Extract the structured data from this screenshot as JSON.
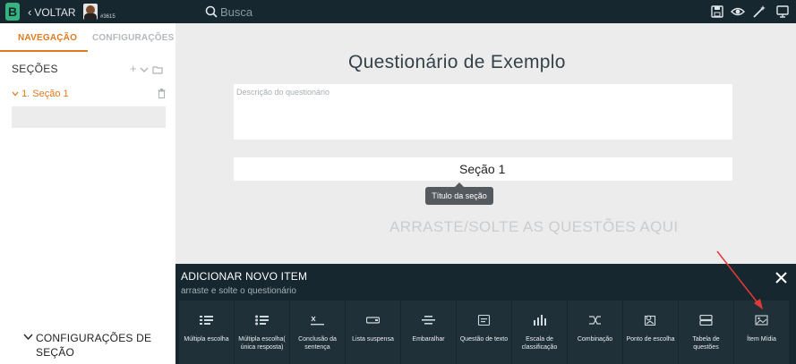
{
  "topbar": {
    "logo": "B",
    "back_label": "VOLTAR",
    "user_id": "#3615",
    "search_placeholder": "Busca",
    "icons": [
      "save-icon",
      "eye-icon",
      "magic-wand-icon",
      "monitor-icon"
    ]
  },
  "sidebar": {
    "tabs": [
      {
        "label": "NAVEGAÇÃO",
        "active": true
      },
      {
        "label": "CONFIGURAÇÕES",
        "active": false
      }
    ],
    "sections_title": "SEÇÕES",
    "section_item": "1. Seção 1",
    "section_config_title": "CONFIGURAÇÕES DE SEÇÃO"
  },
  "main": {
    "title": "Questionário de Exemplo",
    "description_placeholder": "Descrição do questionário",
    "section_title": "Seção 1",
    "tooltip": "Título da seção",
    "dropzone": "ARRASTE/SOLTE AS QUESTÕES AQUI"
  },
  "panel": {
    "title": "ADICIONAR NOVO ITEM",
    "subtitle": "arraste e solte o questionário",
    "tiles": [
      {
        "label": "Múltipla escolha",
        "icon": "list-icon"
      },
      {
        "label": "Múltipla escolha( única resposta)",
        "icon": "radio-list-icon"
      },
      {
        "label": "Conclusão da sentença",
        "icon": "sentence-icon"
      },
      {
        "label": "Lista suspensa",
        "icon": "dropdown-icon"
      },
      {
        "label": "Embaralhar",
        "icon": "shuffle-lines-icon"
      },
      {
        "label": "Questão de texto",
        "icon": "text-box-icon"
      },
      {
        "label": "Escala de classificação",
        "icon": "bar-chart-icon"
      },
      {
        "label": "Combinação",
        "icon": "combine-icon"
      },
      {
        "label": "Ponto de escolha",
        "icon": "image-point-icon"
      },
      {
        "label": "Tabela de questões",
        "icon": "table-icon"
      },
      {
        "label": "Ítem Mídia",
        "icon": "image-icon"
      }
    ]
  },
  "colors": {
    "topbar": "#17272f",
    "accent": "#e07a1f",
    "logo": "#36b37e",
    "annotation": "#e53935"
  }
}
